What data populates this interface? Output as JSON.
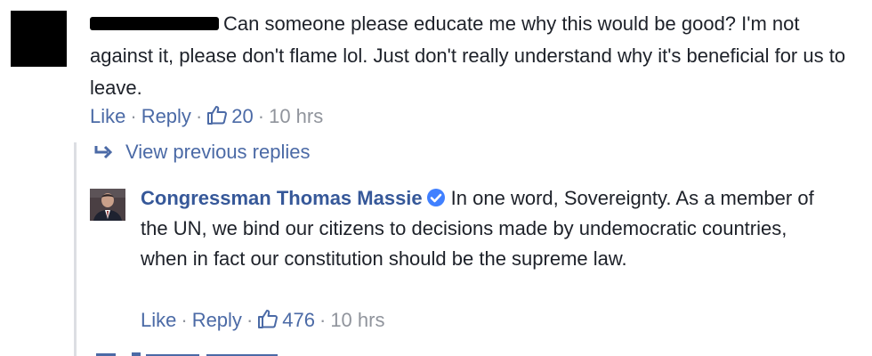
{
  "comment": {
    "text": "Can someone please educate me why this would be good? I'm not against it, please don't flame lol. Just don't really understand why it's beneficial for us to leave.",
    "like_label": "Like",
    "reply_label": "Reply",
    "likes": "20",
    "time": "10 hrs"
  },
  "thread": {
    "view_previous_label": "View previous replies"
  },
  "reply": {
    "author": "Congressman Thomas Massie",
    "text": "In one word, Sovereignty. As a member of the UN, we bind our citizens to decisions made by undemocratic countries, when in fact our constitution should be the supreme law.",
    "like_label": "Like",
    "reply_label": "Reply",
    "likes": "476",
    "time": "10 hrs"
  },
  "colors": {
    "link": "#4b6aa6",
    "author": "#365899",
    "meta": "#90949c",
    "verified": "#4080ff"
  },
  "icons": [
    "thumbs-up-icon",
    "reply-arrow-icon",
    "verified-badge-icon"
  ]
}
